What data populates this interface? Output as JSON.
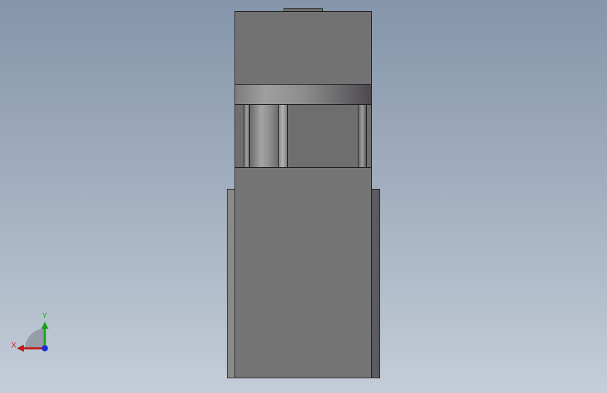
{
  "viewport": {
    "background_top": "#8595aa",
    "background_bottom": "#c4cdd8",
    "part_color": "#747474",
    "edge_color": "#1d1d1d"
  },
  "triad": {
    "x_label": "X",
    "y_label": "Y",
    "x_color": "#c21a1a",
    "y_color": "#18a018",
    "z_color": "#1a30d0"
  },
  "icons": {
    "triad": "coordinate-triad-icon"
  }
}
